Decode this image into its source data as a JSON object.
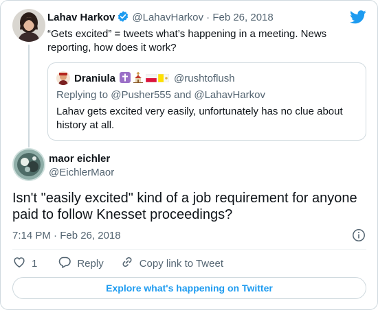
{
  "parent_tweet": {
    "name": "Lahav Harkov",
    "handle_date": "@LahavHarkov · Feb 26, 2018",
    "text": "“Gets excited” = tweets what’s happening in a meeting. News reporting, how does it work?"
  },
  "quoted_tweet": {
    "name": "Draniula",
    "handle": "@rushtoflush",
    "replying_to": "Replying to @Pusher555 and @LahavHarkov",
    "text": "Lahav gets excited very easily, unfortunately has no clue about history at all."
  },
  "main_tweet": {
    "name": "maor eichler",
    "handle": "@EichlerMaor",
    "text": "Isn't \"easily excited\" kind of a job requirement for anyone paid to follow Knesset proceedings?",
    "timestamp": "7:14 PM · Feb 26, 2018"
  },
  "actions": {
    "like_count": "1",
    "reply_label": "Reply",
    "copy_link_label": "Copy link to Tweet"
  },
  "explore_label": "Explore what's happening on Twitter",
  "icons": [
    "twitter-logo-icon",
    "verified-badge-icon",
    "info-icon",
    "heart-icon",
    "reply-icon",
    "link-icon",
    "cross-emoji-icon",
    "church-emoji-icon",
    "poland-flag-icon",
    "vatican-flag-icon"
  ],
  "colors": {
    "accent": "#1d9bf0",
    "secondary_text": "#536471",
    "border": "#cfd9de"
  }
}
